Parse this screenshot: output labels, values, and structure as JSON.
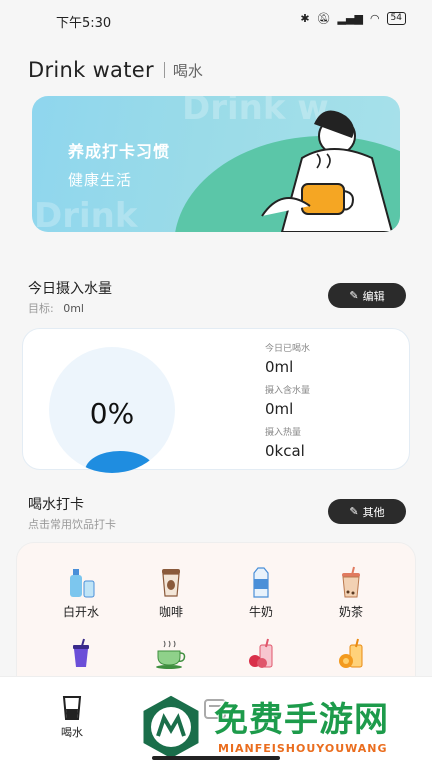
{
  "status_bar": {
    "time": "下午5:30",
    "battery": "54"
  },
  "header": {
    "title_en": "Drink water",
    "title_cn": "喝水"
  },
  "banner": {
    "line1": "养成打卡习惯",
    "line2": "健康生活",
    "ghost_top": "Drink w",
    "ghost_left": "Drink"
  },
  "intake": {
    "title": "今日摄入水量",
    "target_label": "目标:",
    "target_value": "0ml",
    "edit_label": "编辑",
    "percent": "0%",
    "progress_fraction": 0,
    "stats": [
      {
        "label": "今日已喝水",
        "value": "0ml"
      },
      {
        "label": "摄入含水量",
        "value": "0ml"
      },
      {
        "label": "摄入热量",
        "value": "0kcal"
      }
    ],
    "accent_color": "#1f8de0"
  },
  "checkin": {
    "title": "喝水打卡",
    "subtitle": "点击常用饮品打卡",
    "other_label": "其他",
    "drinks": [
      {
        "name": "白开水",
        "icon": "water-bottle-icon"
      },
      {
        "name": "咖啡",
        "icon": "coffee-cup-icon"
      },
      {
        "name": "牛奶",
        "icon": "milk-carton-icon"
      },
      {
        "name": "奶茶",
        "icon": "milk-tea-icon"
      },
      {
        "name": "",
        "icon": "purple-drink-icon"
      },
      {
        "name": "",
        "icon": "tea-cup-icon"
      },
      {
        "name": "",
        "icon": "fruit-juice-icon"
      },
      {
        "name": "",
        "icon": "orange-juice-icon"
      }
    ]
  },
  "bottom_nav": {
    "items": [
      {
        "label": "喝水",
        "icon": "water-glass-icon"
      },
      {
        "label": "",
        "icon": "record-icon"
      }
    ]
  },
  "watermark": {
    "cn": "免费手游网",
    "en": "MIANFEISHOUYOUWANG"
  }
}
